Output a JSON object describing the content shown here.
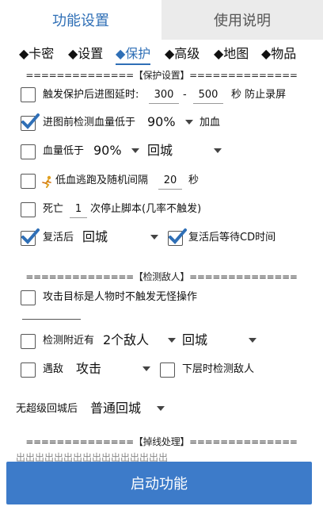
{
  "tabs": [
    {
      "label": "功能设置",
      "active": true
    },
    {
      "label": "使用说明",
      "active": false
    }
  ],
  "subtabs": [
    "◆卡密",
    "◆设置",
    "◆保护",
    "◆高级",
    "◆地图",
    "◆物品"
  ],
  "sections": {
    "protect": "==============【保护设置】==============",
    "enemy": "==============【检测敌人】==============",
    "offline": "==============【掉线处理】=============="
  },
  "short_divider": "------------------",
  "rows": {
    "map_delay": {
      "label": "触发保护后进图延时:",
      "from": "300",
      "dash": "-",
      "to": "500",
      "suffix": "秒 防止录屏",
      "checked": false
    },
    "hp_check": {
      "label": "进图前检测血量低于",
      "value": "90%",
      "suffix": "加血",
      "checked": true
    },
    "hp_low": {
      "label": "血量低于",
      "value": "90%",
      "action": "回城",
      "checked": false
    },
    "escape": {
      "label": "低血逃跑及随机间隔",
      "value": "20",
      "suffix": "秒",
      "checked": false
    },
    "death": {
      "label": "死亡",
      "value": "1",
      "suffix": "次停止脚本(几率不触发)",
      "checked": false
    },
    "revive": {
      "label": "复活后",
      "action": "回城",
      "checked": true,
      "cd_label": "复活后等待CD时间",
      "cd_checked": true
    },
    "attack_player": {
      "label": "攻击目标是人物时不触发无怪操作",
      "checked": false
    },
    "detect_near": {
      "label": "检测附近有",
      "count": "2个敌人",
      "action": "回城",
      "checked": false
    },
    "encounter": {
      "label": "遇敌",
      "action": "攻击",
      "checked": false,
      "lower_label": "下层时检测敌人",
      "lower_checked": false
    },
    "no_super": {
      "label": "无超级回城后",
      "action": "普通回城"
    }
  },
  "faded_text": "出出出出出出出出出出出出出出出出",
  "start_button": "启动功能",
  "colors": {
    "accent": "#2f6fb6",
    "button": "#3d7bc9",
    "tab_inactive": "#ebebeb"
  }
}
